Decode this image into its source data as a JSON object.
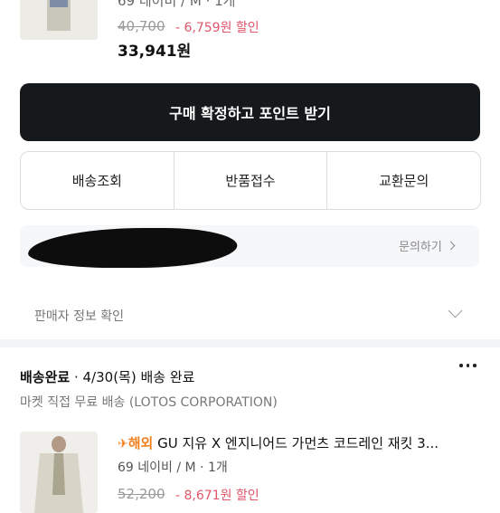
{
  "top_product": {
    "option": "69 네이비 / M · 1개",
    "original_price": "40,700",
    "discount": "- 6,759원 할인",
    "final_price": "33,941원"
  },
  "confirm_button": "구매 확정하고 포인트 받기",
  "actions": [
    "배송조회",
    "반품접수",
    "교환문의"
  ],
  "inquiry": {
    "link": "문의하기"
  },
  "seller_info": "판매자 정보 확인",
  "delivery": {
    "status": "배송완료",
    "date": " · 4/30(목) 배송 완료",
    "sub": "마켓 직접 무료 배송 (LOTOS CORPORATION)"
  },
  "product2": {
    "badge_icon": "✈",
    "badge": "해외",
    "title": " GU 지유 X 엔지니어드 가먼츠 코드레인 재킷 3...",
    "option": "69 네이비 / M · 1개",
    "original_price": "52,200",
    "discount": "- 8,671원 할인"
  }
}
